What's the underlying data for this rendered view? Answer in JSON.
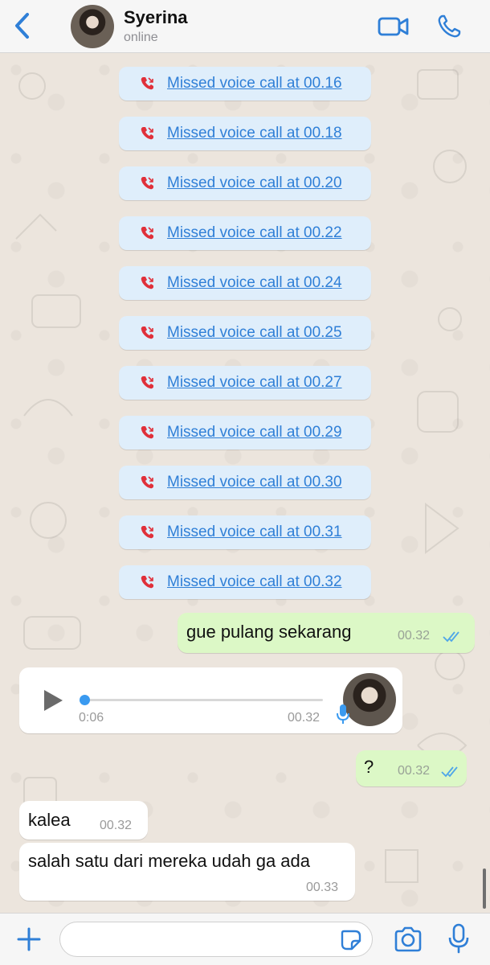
{
  "header": {
    "contact_name": "Syerina",
    "status": "online",
    "icons": {
      "back": "chevron-left-icon",
      "video": "video-camera-icon",
      "call": "phone-icon"
    }
  },
  "missed_calls": [
    "Missed voice call at 00.16",
    "Missed voice call at 00.18",
    "Missed voice call at 00.20",
    "Missed voice call at 00.22",
    "Missed voice call at 00.24",
    "Missed voice call at 00.25",
    "Missed voice call at 00.27",
    "Missed voice call at 00.29",
    "Missed voice call at 00.30",
    "Missed voice call at 00.31",
    "Missed voice call at 00.32"
  ],
  "messages": {
    "out1": {
      "text": "gue pulang sekarang",
      "time": "00.32",
      "status": "read"
    },
    "voice": {
      "duration": "0:06",
      "time": "00.32",
      "progress": 0
    },
    "out2": {
      "text": "?",
      "time": "00.32",
      "status": "read"
    },
    "in1": {
      "text": "kalea",
      "time": "00.32"
    },
    "in2": {
      "text": "salah satu dari mereka udah ga ada",
      "time": "00.33"
    }
  },
  "composer": {
    "value": "",
    "icons": {
      "attach": "plus-icon",
      "sticker": "sticker-icon",
      "camera": "camera-icon",
      "mic": "microphone-icon"
    }
  },
  "colors": {
    "accent": "#2f7fd7",
    "missed_call_red": "#e0303a",
    "outgoing_bubble": "#dcf8c6",
    "incoming_bubble": "#ffffff",
    "missed_call_bubble": "#dfeefb",
    "read_ticks": "#4fa6e8",
    "chat_background": "#ece5dd"
  }
}
